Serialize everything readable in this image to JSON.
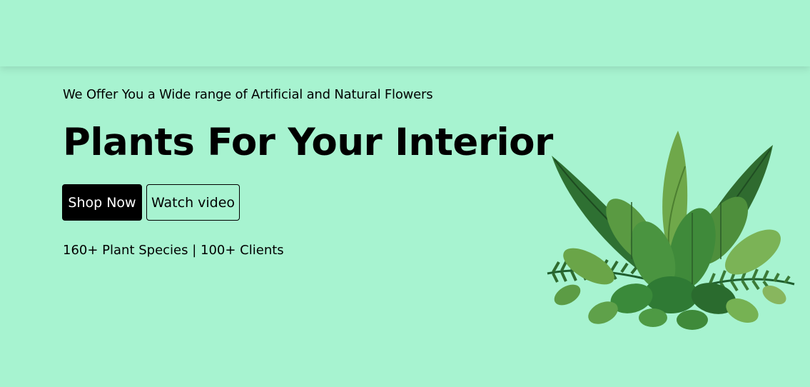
{
  "hero": {
    "tagline": "We Offer You a Wide range of Artificial and Natural Flowers",
    "title": "Plants For Your Interior",
    "primary_button": "Shop Now",
    "secondary_button": "Watch video",
    "stats": "160+ Plant Species | 100+ Clients",
    "image_icon": "plant-bouquet-image"
  },
  "colors": {
    "background": "#a7f3d0",
    "primary_button_bg": "#000000",
    "primary_button_text": "#ffffff",
    "leaf_dark": "#1f5e2e",
    "leaf_mid": "#3f8a3a",
    "leaf_light": "#7bb356"
  }
}
